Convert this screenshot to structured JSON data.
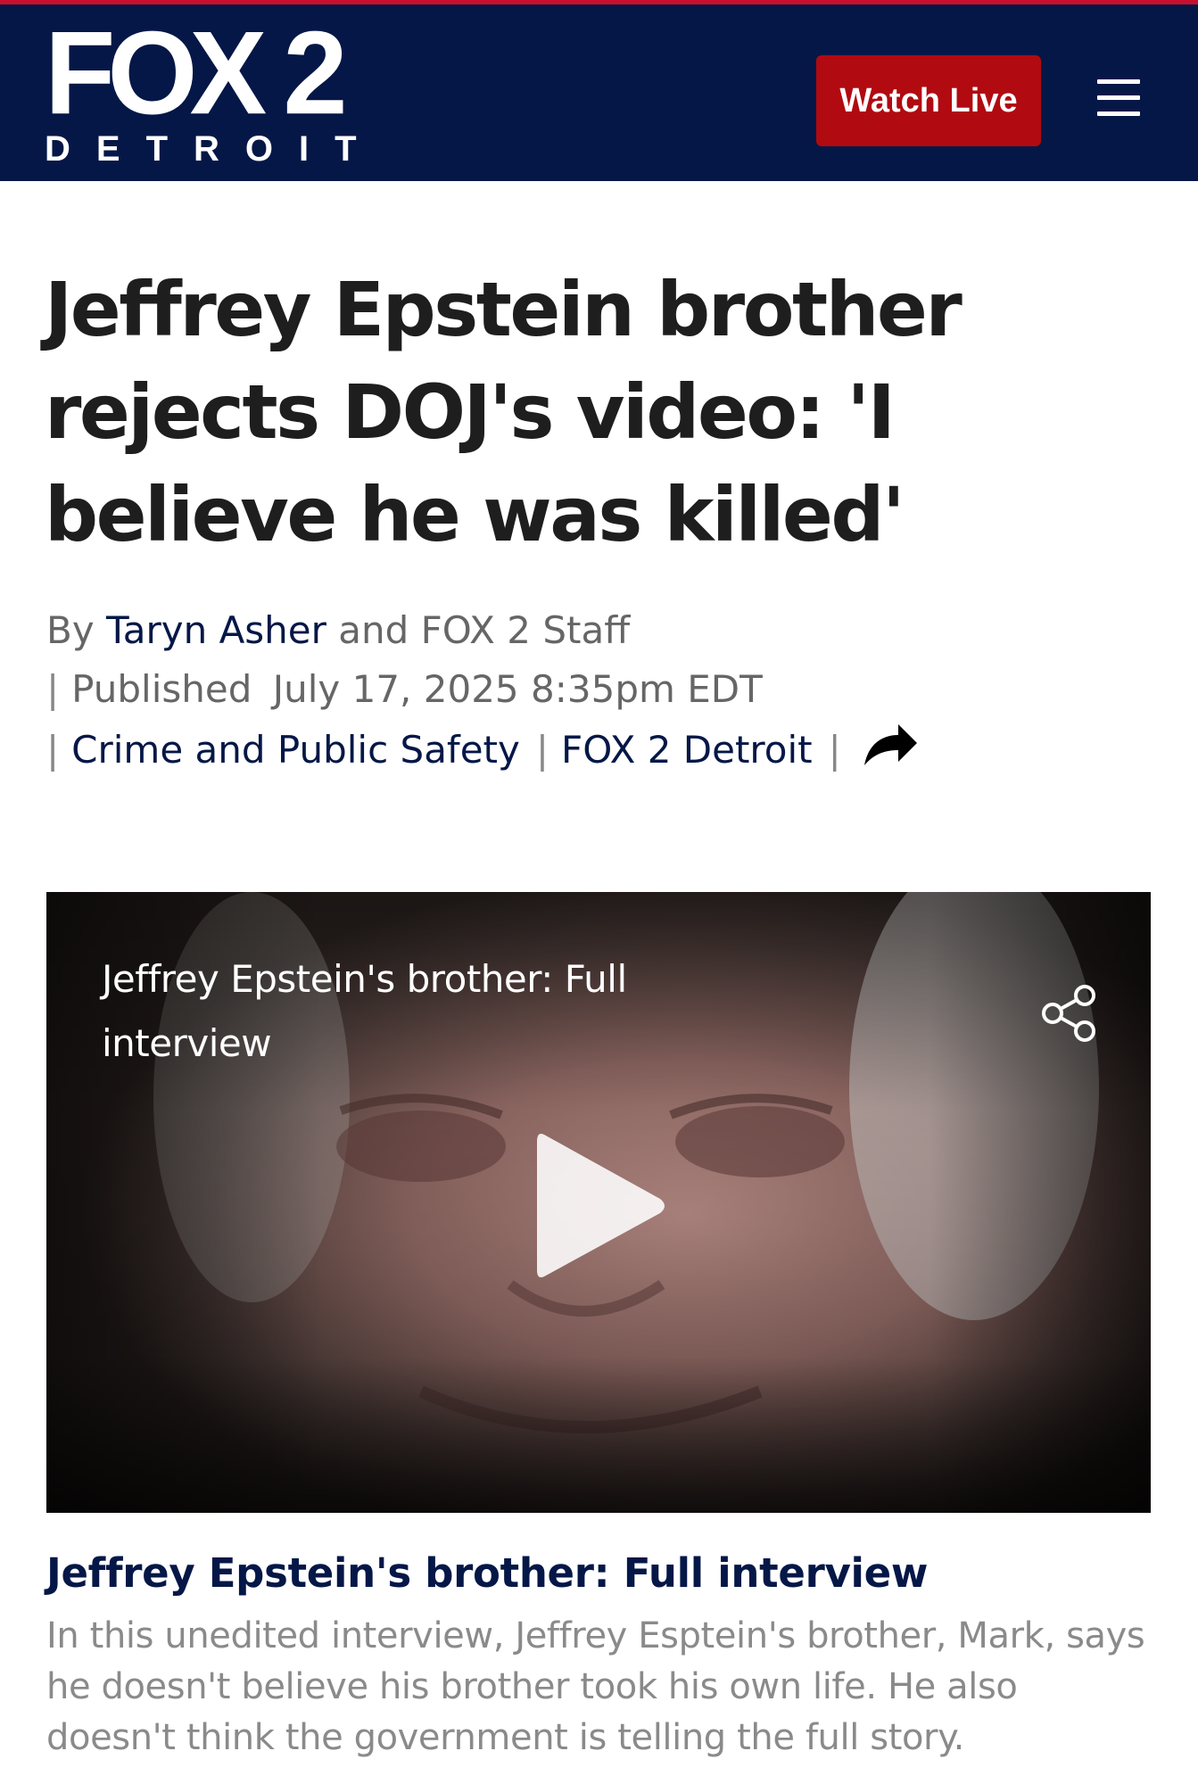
{
  "header": {
    "logo_main": "FOX 2",
    "logo_sub": "DETROIT",
    "watch_live_label": "Watch Live",
    "menu_icon": "hamburger-menu-icon",
    "background_color": "#051747",
    "accent_color": "#b10a11"
  },
  "article": {
    "headline": "Jeffrey Epstein brother rejects DOJ's video: 'I believe he was killed'",
    "byline": {
      "by_label": "By",
      "author": "Taryn Asher",
      "and_label": "and FOX 2 Staff",
      "separator": "|",
      "published_label": "Published",
      "published_date": "July 17, 2025 8:35pm EDT",
      "category": "Crime and Public Safety",
      "source": "FOX 2 Detroit",
      "share_icon": "share-arrow-icon"
    }
  },
  "video": {
    "overlay_title": "Jeffrey Epstein's brother: Full interview",
    "share_icon": "share-nodes-icon",
    "play_icon": "play-icon",
    "caption_title": "Jeffrey Epstein's brother: Full interview",
    "caption_description": "In this unedited interview, Jeffrey Esptein's brother, Mark, says he doesn't believe his brother took his own life. He also doesn't think the government is telling the full story."
  }
}
